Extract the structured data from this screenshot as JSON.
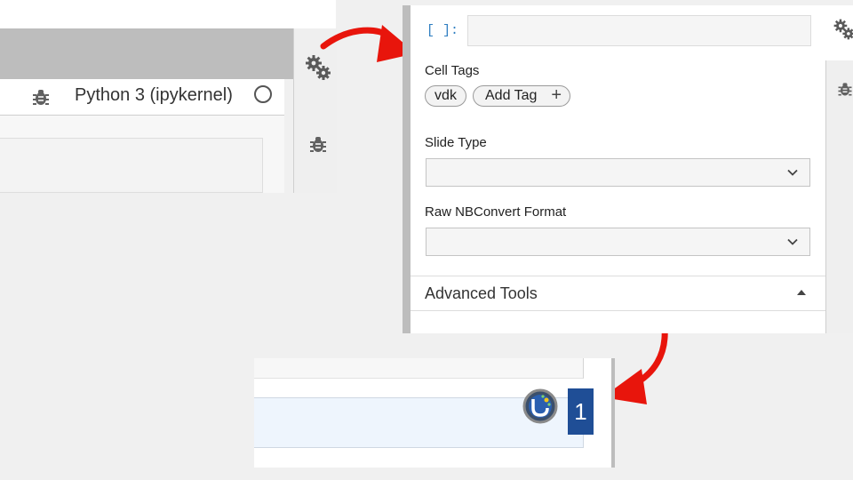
{
  "top_left_panel": {
    "kernel_name": "Python 3 (ipykernel)",
    "icons": {
      "toolbar_debug": "bug-icon",
      "kernel_status": "circle-icon",
      "rail_settings": "gears-icon",
      "rail_debug": "bug-icon"
    }
  },
  "property_inspector": {
    "prompt": "[ ]:",
    "cell_tags_label": "Cell Tags",
    "tags": [
      "vdk"
    ],
    "add_tag_label": "Add Tag",
    "slide_type_label": "Slide Type",
    "slide_type_value": "",
    "raw_format_label": "Raw NBConvert Format",
    "raw_format_value": "",
    "advanced_tools_label": "Advanced Tools"
  },
  "bottom_panel": {
    "badge_number": "1"
  },
  "colors": {
    "arrow": "#e8150c",
    "prompt": "#307fc1",
    "badge": "#1f4e96",
    "selected_cell": "#eef5fd"
  }
}
